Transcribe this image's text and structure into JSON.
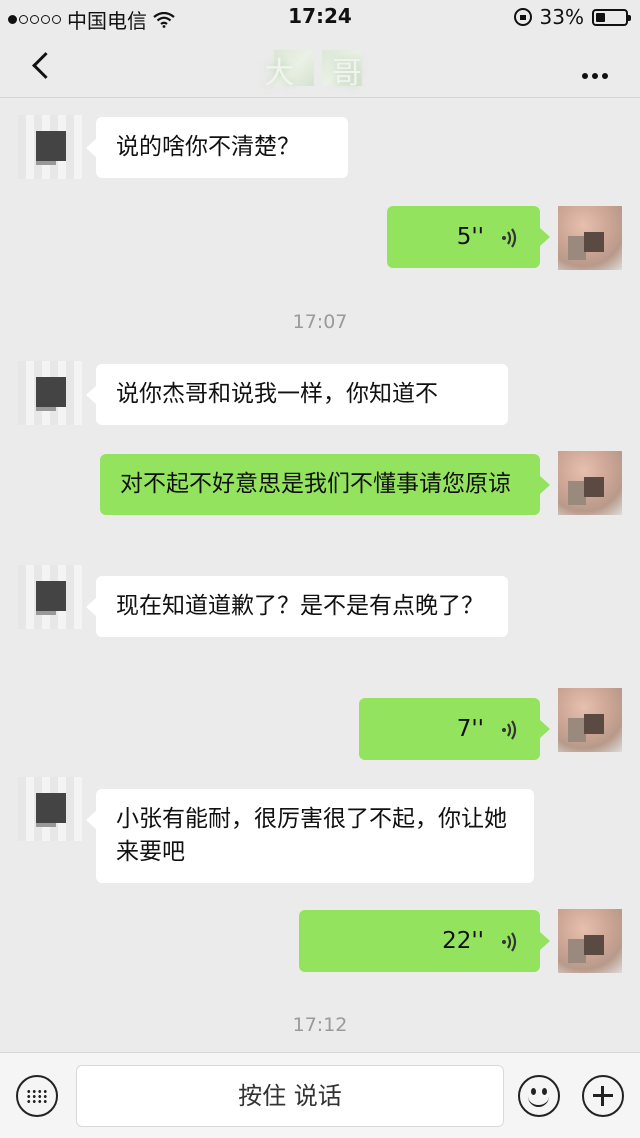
{
  "status_bar": {
    "carrier": "中国电信",
    "time": "17:24",
    "battery": "33%"
  },
  "nav": {
    "title": "大 哥",
    "more": "•••"
  },
  "messages": [
    {
      "side": "in",
      "type": "text",
      "text": "说的啥你不清楚？"
    },
    {
      "side": "out",
      "type": "voice",
      "duration": "5''"
    },
    {
      "type": "time",
      "text": "17:07"
    },
    {
      "side": "in",
      "type": "text",
      "text": "说你杰哥和说我一样，你知道不"
    },
    {
      "side": "out",
      "type": "text",
      "text": "对不起不好意思是我们不懂事请您原谅"
    },
    {
      "side": "in",
      "type": "text",
      "text": "现在知道道歉了？是不是有点晚了？"
    },
    {
      "side": "out",
      "type": "voice",
      "duration": "7''"
    },
    {
      "side": "in",
      "type": "text",
      "text": "小张有能耐，很厉害很了不起，你让她来要吧"
    },
    {
      "side": "out",
      "type": "voice",
      "duration": "22''"
    },
    {
      "type": "time",
      "text": "17:12"
    }
  ],
  "bottom": {
    "talk_label": "按住 说话"
  },
  "colors": {
    "out_bubble": "#94e35f",
    "in_bubble": "#ffffff",
    "background": "#ebebeb"
  }
}
